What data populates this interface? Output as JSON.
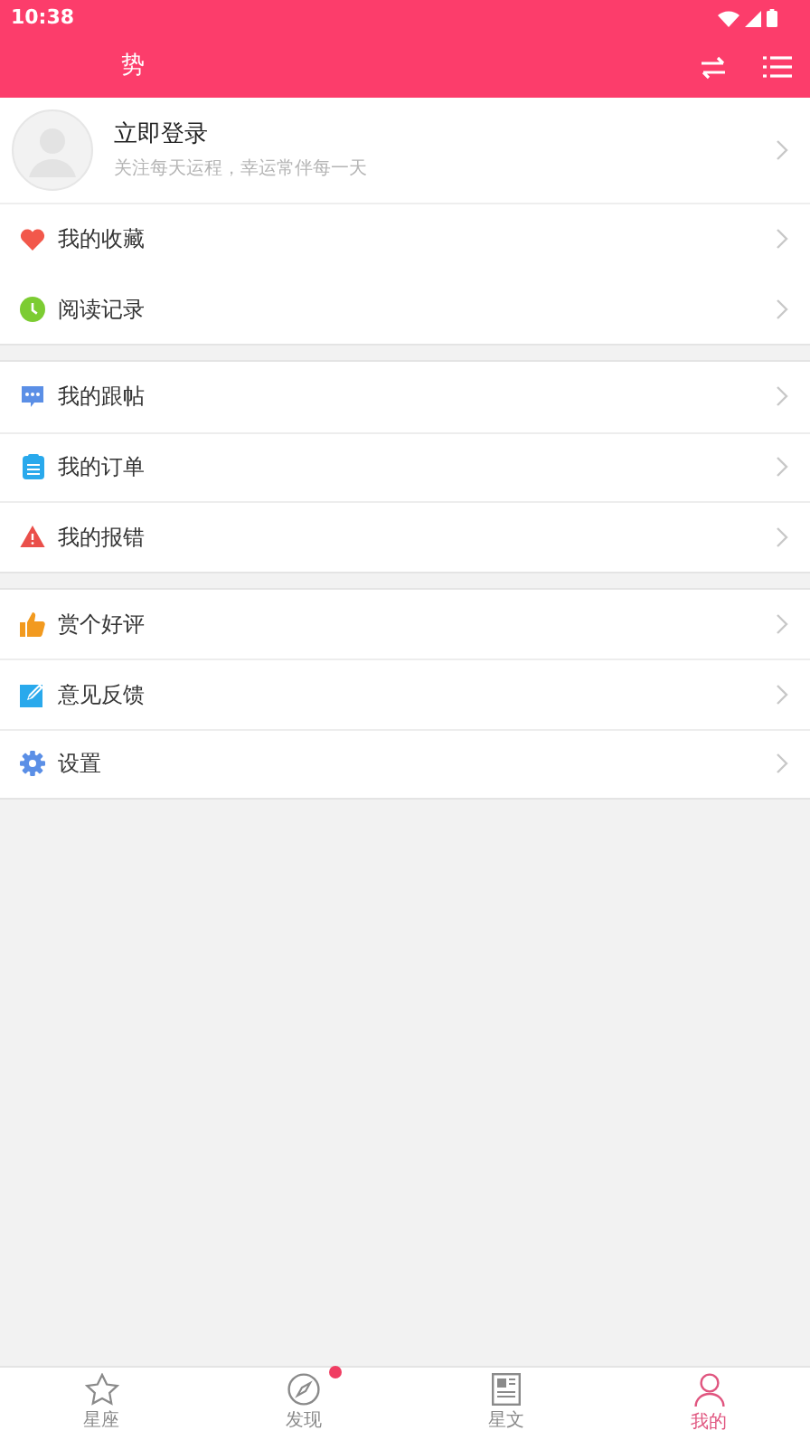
{
  "status_bar": {
    "time": "10:38"
  },
  "header": {
    "title": "势"
  },
  "login": {
    "title": "立即登录",
    "subtitle": "关注每天运程，幸运常伴每一天"
  },
  "sections": [
    {
      "items": [
        {
          "label": "我的收藏"
        },
        {
          "label": "阅读记录"
        }
      ]
    },
    {
      "items": [
        {
          "label": "我的跟帖"
        },
        {
          "label": "我的订单"
        },
        {
          "label": "我的报错"
        }
      ]
    },
    {
      "items": [
        {
          "label": "赏个好评"
        },
        {
          "label": "意见反馈"
        },
        {
          "label": "设置"
        }
      ]
    }
  ],
  "tabs": [
    {
      "label": "星座",
      "selected": false,
      "badge": false
    },
    {
      "label": "发现",
      "selected": false,
      "badge": true
    },
    {
      "label": "星文",
      "selected": false,
      "badge": false
    },
    {
      "label": "我的",
      "selected": true,
      "badge": false
    }
  ]
}
